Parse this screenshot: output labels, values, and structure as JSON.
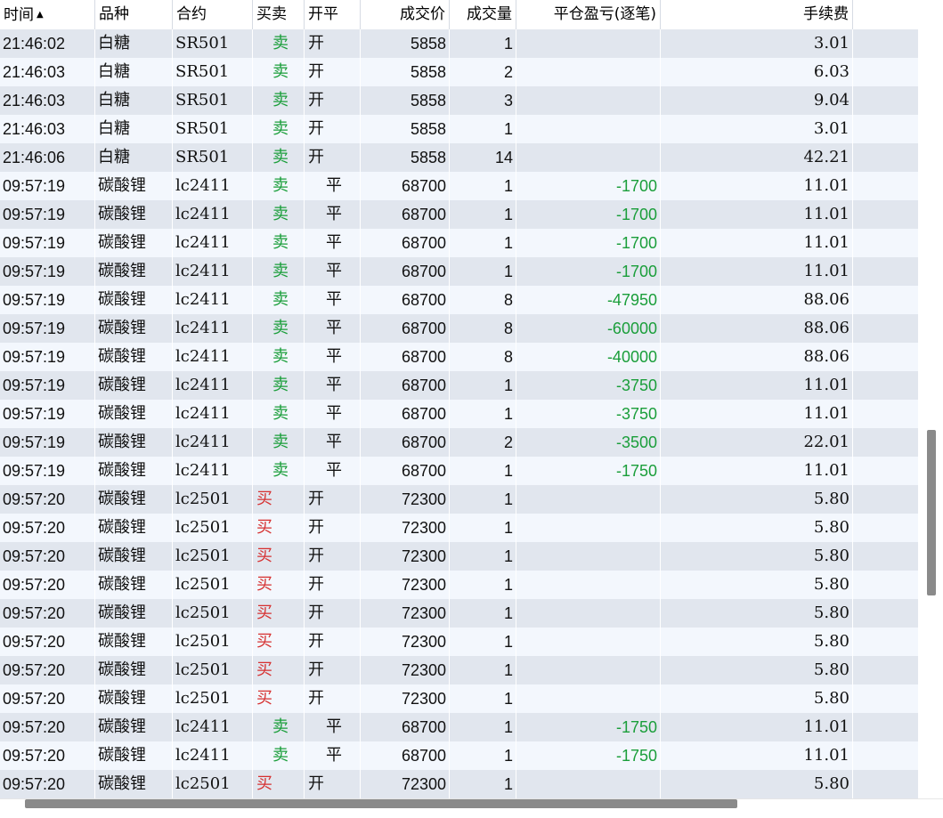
{
  "header": {
    "time": "时间",
    "product": "品种",
    "contract": "合约",
    "side": "买卖",
    "offset": "开平",
    "price": "成交价",
    "volume": "成交量",
    "pnl": "平仓盈亏(逐笔)",
    "fee": "手续费"
  },
  "sort_icon": "▲",
  "colors": {
    "sell": "#1a9e3a",
    "buy": "#d63030",
    "row_odd": "#e1e6ee",
    "row_even": "#f3f7fd"
  },
  "rows": [
    {
      "time": "21:46:02",
      "product": "白糖",
      "contract": "SR501",
      "side": "卖",
      "offset": "开",
      "price": "5858",
      "volume": "1",
      "pnl": "",
      "fee": "3.01"
    },
    {
      "time": "21:46:03",
      "product": "白糖",
      "contract": "SR501",
      "side": "卖",
      "offset": "开",
      "price": "5858",
      "volume": "2",
      "pnl": "",
      "fee": "6.03"
    },
    {
      "time": "21:46:03",
      "product": "白糖",
      "contract": "SR501",
      "side": "卖",
      "offset": "开",
      "price": "5858",
      "volume": "3",
      "pnl": "",
      "fee": "9.04"
    },
    {
      "time": "21:46:03",
      "product": "白糖",
      "contract": "SR501",
      "side": "卖",
      "offset": "开",
      "price": "5858",
      "volume": "1",
      "pnl": "",
      "fee": "3.01"
    },
    {
      "time": "21:46:06",
      "product": "白糖",
      "contract": "SR501",
      "side": "卖",
      "offset": "开",
      "price": "5858",
      "volume": "14",
      "pnl": "",
      "fee": "42.21"
    },
    {
      "time": "09:57:19",
      "product": "碳酸锂",
      "contract": "lc2411",
      "side": "卖",
      "offset": "平",
      "price": "68700",
      "volume": "1",
      "pnl": "-1700",
      "fee": "11.01"
    },
    {
      "time": "09:57:19",
      "product": "碳酸锂",
      "contract": "lc2411",
      "side": "卖",
      "offset": "平",
      "price": "68700",
      "volume": "1",
      "pnl": "-1700",
      "fee": "11.01"
    },
    {
      "time": "09:57:19",
      "product": "碳酸锂",
      "contract": "lc2411",
      "side": "卖",
      "offset": "平",
      "price": "68700",
      "volume": "1",
      "pnl": "-1700",
      "fee": "11.01"
    },
    {
      "time": "09:57:19",
      "product": "碳酸锂",
      "contract": "lc2411",
      "side": "卖",
      "offset": "平",
      "price": "68700",
      "volume": "1",
      "pnl": "-1700",
      "fee": "11.01"
    },
    {
      "time": "09:57:19",
      "product": "碳酸锂",
      "contract": "lc2411",
      "side": "卖",
      "offset": "平",
      "price": "68700",
      "volume": "8",
      "pnl": "-47950",
      "fee": "88.06"
    },
    {
      "time": "09:57:19",
      "product": "碳酸锂",
      "contract": "lc2411",
      "side": "卖",
      "offset": "平",
      "price": "68700",
      "volume": "8",
      "pnl": "-60000",
      "fee": "88.06"
    },
    {
      "time": "09:57:19",
      "product": "碳酸锂",
      "contract": "lc2411",
      "side": "卖",
      "offset": "平",
      "price": "68700",
      "volume": "8",
      "pnl": "-40000",
      "fee": "88.06"
    },
    {
      "time": "09:57:19",
      "product": "碳酸锂",
      "contract": "lc2411",
      "side": "卖",
      "offset": "平",
      "price": "68700",
      "volume": "1",
      "pnl": "-3750",
      "fee": "11.01"
    },
    {
      "time": "09:57:19",
      "product": "碳酸锂",
      "contract": "lc2411",
      "side": "卖",
      "offset": "平",
      "price": "68700",
      "volume": "1",
      "pnl": "-3750",
      "fee": "11.01"
    },
    {
      "time": "09:57:19",
      "product": "碳酸锂",
      "contract": "lc2411",
      "side": "卖",
      "offset": "平",
      "price": "68700",
      "volume": "2",
      "pnl": "-3500",
      "fee": "22.01"
    },
    {
      "time": "09:57:19",
      "product": "碳酸锂",
      "contract": "lc2411",
      "side": "卖",
      "offset": "平",
      "price": "68700",
      "volume": "1",
      "pnl": "-1750",
      "fee": "11.01"
    },
    {
      "time": "09:57:20",
      "product": "碳酸锂",
      "contract": "lc2501",
      "side": "买",
      "offset": "开",
      "price": "72300",
      "volume": "1",
      "pnl": "",
      "fee": "5.80"
    },
    {
      "time": "09:57:20",
      "product": "碳酸锂",
      "contract": "lc2501",
      "side": "买",
      "offset": "开",
      "price": "72300",
      "volume": "1",
      "pnl": "",
      "fee": "5.80"
    },
    {
      "time": "09:57:20",
      "product": "碳酸锂",
      "contract": "lc2501",
      "side": "买",
      "offset": "开",
      "price": "72300",
      "volume": "1",
      "pnl": "",
      "fee": "5.80"
    },
    {
      "time": "09:57:20",
      "product": "碳酸锂",
      "contract": "lc2501",
      "side": "买",
      "offset": "开",
      "price": "72300",
      "volume": "1",
      "pnl": "",
      "fee": "5.80"
    },
    {
      "time": "09:57:20",
      "product": "碳酸锂",
      "contract": "lc2501",
      "side": "买",
      "offset": "开",
      "price": "72300",
      "volume": "1",
      "pnl": "",
      "fee": "5.80"
    },
    {
      "time": "09:57:20",
      "product": "碳酸锂",
      "contract": "lc2501",
      "side": "买",
      "offset": "开",
      "price": "72300",
      "volume": "1",
      "pnl": "",
      "fee": "5.80"
    },
    {
      "time": "09:57:20",
      "product": "碳酸锂",
      "contract": "lc2501",
      "side": "买",
      "offset": "开",
      "price": "72300",
      "volume": "1",
      "pnl": "",
      "fee": "5.80"
    },
    {
      "time": "09:57:20",
      "product": "碳酸锂",
      "contract": "lc2501",
      "side": "买",
      "offset": "开",
      "price": "72300",
      "volume": "1",
      "pnl": "",
      "fee": "5.80"
    },
    {
      "time": "09:57:20",
      "product": "碳酸锂",
      "contract": "lc2411",
      "side": "卖",
      "offset": "平",
      "price": "68700",
      "volume": "1",
      "pnl": "-1750",
      "fee": "11.01"
    },
    {
      "time": "09:57:20",
      "product": "碳酸锂",
      "contract": "lc2411",
      "side": "卖",
      "offset": "平",
      "price": "68700",
      "volume": "1",
      "pnl": "-1750",
      "fee": "11.01"
    },
    {
      "time": "09:57:20",
      "product": "碳酸锂",
      "contract": "lc2501",
      "side": "买",
      "offset": "开",
      "price": "72300",
      "volume": "1",
      "pnl": "",
      "fee": "5.80"
    }
  ]
}
